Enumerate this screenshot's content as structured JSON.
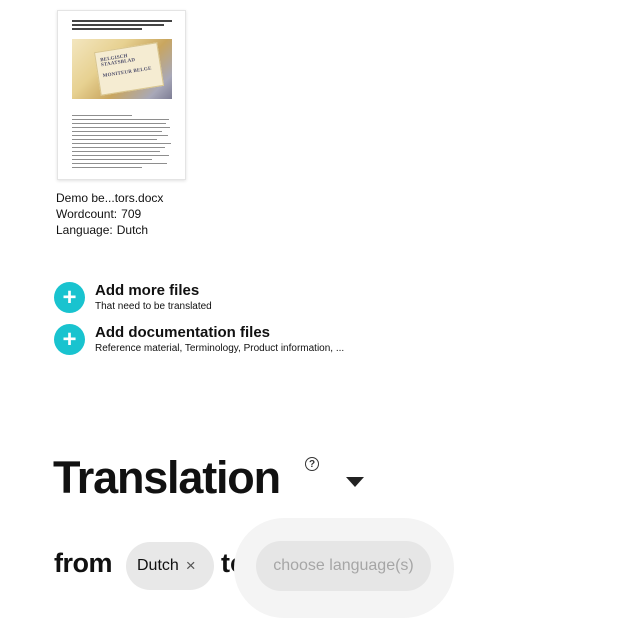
{
  "file": {
    "name": "Demo be...tors.docx",
    "wordcount_label": "Wordcount:",
    "wordcount_value": "709",
    "language_label": "Language:",
    "language_value": "Dutch",
    "thumbnail_title_1": "BELGISCH STAATSBLAD",
    "thumbnail_title_2": "MONITEUR BELGE"
  },
  "actions": {
    "add_files": {
      "title": "Add more files",
      "subtitle": "That need to be translated"
    },
    "add_docs": {
      "title": "Add documentation files",
      "subtitle": "Reference material, Terminology, Product information, ..."
    }
  },
  "translation": {
    "title": "Translation",
    "help": "?",
    "from_label": "from",
    "source_language": "Dutch",
    "remove_symbol": "×",
    "to_label": "to",
    "target_placeholder": "choose language(s)"
  },
  "colors": {
    "accent": "#19c3cf",
    "chip_bg": "#e8e8e8",
    "placeholder": "#a6a6a6"
  },
  "icons": {
    "add": "plus-icon",
    "remove": "close-icon",
    "help": "help-icon",
    "dropdown": "caret-down-icon"
  }
}
